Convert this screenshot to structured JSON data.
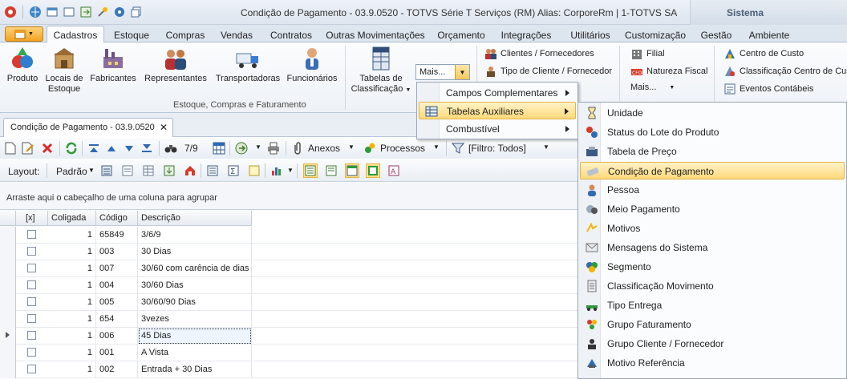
{
  "window": {
    "title": "Condição de Pagamento - 03.9.0520 - TOTVS Série T Serviços (RM) Alias: CorporeRm | 1-TOTVS SA",
    "side_panel": "Sistema"
  },
  "ribbon_tabs": [
    "Cadastros",
    "Estoque",
    "Compras",
    "Vendas",
    "Contratos",
    "Outras Movimentações",
    "Orçamento",
    "Integrações",
    "Utilitários",
    "Customização",
    "Gestão",
    "Ambiente"
  ],
  "ribbon": {
    "big_buttons": [
      "Produto",
      "Locais de Estoque",
      "Fabricantes",
      "Representantes",
      "Transportadoras",
      "Funcionários",
      "Tabelas de Classificação"
    ],
    "tabelas_label_1": "Tabelas de",
    "tabelas_label_2": "Classificação",
    "locais_label_1": "Locais de",
    "locais_label_2": "Estoque",
    "group_label": "Estoque, Compras e Faturamento",
    "mais_combo": "Mais...",
    "small_col1": [
      "Clientes / Fornecedores",
      "Tipo de Cliente / Fornecedor"
    ],
    "small_col2": [
      "Filial",
      "Natureza Fiscal",
      "Mais..."
    ],
    "small_col3": [
      "Centro de Custo",
      "Classificação Centro de Cus",
      "Eventos Contábeis"
    ]
  },
  "document_tab": "Condição de Pagamento - 03.9.0520",
  "toolbar": {
    "record_counter": "7/9",
    "anexos": "Anexos",
    "processos": "Processos",
    "filtro": "[Filtro: Todos]",
    "layout_label": "Layout:",
    "layout_value": "Padrão"
  },
  "grid": {
    "group_hint": "Arraste aqui o cabeçalho de uma coluna para agrupar",
    "headers": [
      "[x]",
      "Coligada",
      "Código",
      "Descrição"
    ],
    "rows": [
      {
        "coligada": "1",
        "codigo": "65849",
        "descricao": "3/6/9"
      },
      {
        "coligada": "1",
        "codigo": "003",
        "descricao": "30 Dias"
      },
      {
        "coligada": "1",
        "codigo": "007",
        "descricao": "30/60 com carência de dias"
      },
      {
        "coligada": "1",
        "codigo": "004",
        "descricao": "30/60 Dias"
      },
      {
        "coligada": "1",
        "codigo": "005",
        "descricao": "30/60/90 Dias"
      },
      {
        "coligada": "1",
        "codigo": "654",
        "descricao": "3vezes"
      },
      {
        "coligada": "1",
        "codigo": "006",
        "descricao": "45 Dias"
      },
      {
        "coligada": "1",
        "codigo": "001",
        "descricao": "A Vista"
      },
      {
        "coligada": "1",
        "codigo": "002",
        "descricao": "Entrada + 30 Dias"
      }
    ]
  },
  "menu_mais": [
    "Campos Complementares",
    "Tabelas Auxiliares",
    "Combustível"
  ],
  "menu_tabelas_auxiliares": [
    "Unidade",
    "Status do Lote do Produto",
    "Tabela de Preço",
    "Condição de Pagamento",
    "Pessoa",
    "Meio Pagamento",
    "Motivos",
    "Mensagens do Sistema",
    "Segmento",
    "Classificação Movimento",
    "Tipo Entrega",
    "Grupo Faturamento",
    "Grupo Cliente / Fornecedor",
    "Motivo Referência"
  ],
  "colors": {
    "accent": "#f3a420",
    "highlight": "#ffd97a",
    "ribbon_bg": "#dde5ef"
  }
}
